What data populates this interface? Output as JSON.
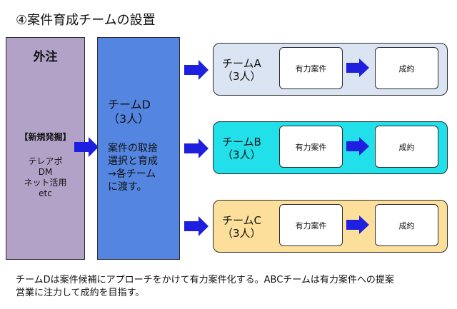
{
  "title": "④案件育成チームの設置",
  "colors": {
    "outsource_fill": "#b3a2c7",
    "team_d_fill": "#5485e0",
    "team_a_fill": "#dae4f2",
    "team_b_fill": "#22e0ea",
    "team_c_fill": "#fbdf9a",
    "arrow_fill": "#1f1fe0"
  },
  "outsource": {
    "heading": "外注",
    "subheading": "【新規発掘】",
    "methods": [
      "テレアポ",
      "DM",
      "ネット活用",
      "etc"
    ]
  },
  "team_d": {
    "name": "チームD",
    "count": "（3人）",
    "description": [
      "案件の取捨",
      "選択と育成",
      "→各チーム",
      "に渡す。"
    ]
  },
  "teams": [
    {
      "name": "チームA",
      "count": "（3人）",
      "prospect": "有力案件",
      "contract": "成約"
    },
    {
      "name": "チームB",
      "count": "（3人）",
      "prospect": "有力案件",
      "contract": "成約"
    },
    {
      "name": "チームC",
      "count": "（3人）",
      "prospect": "有力案件",
      "contract": "成約"
    }
  ],
  "footer": [
    "チームDは案件候補にアプローチをかけて有力案件化する。ABCチームは有力案件への提案",
    "営業に注力して成約を目指す。"
  ]
}
